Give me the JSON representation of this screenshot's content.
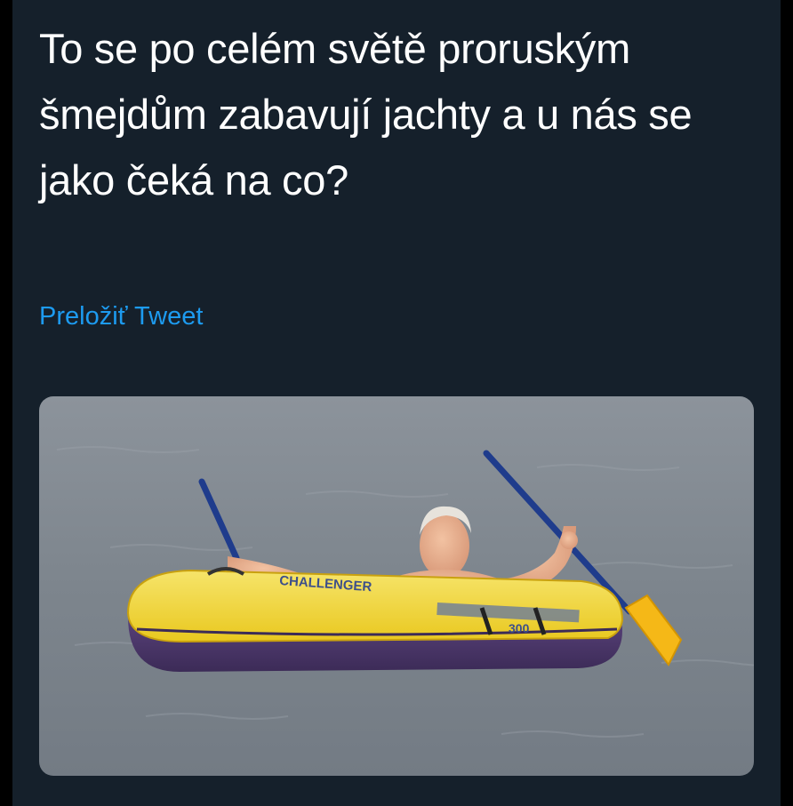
{
  "tweet": {
    "text": "To se po celém světě proruským šmejdům zabavují jachty a u nás se jako čeká na co?",
    "translate_label": "Preložiť Tweet"
  },
  "media": {
    "boat_label": "CHALLENGER",
    "boat_model": "300"
  },
  "colors": {
    "background": "#15202b",
    "text": "#ffffff",
    "link": "#1d9bf0"
  }
}
